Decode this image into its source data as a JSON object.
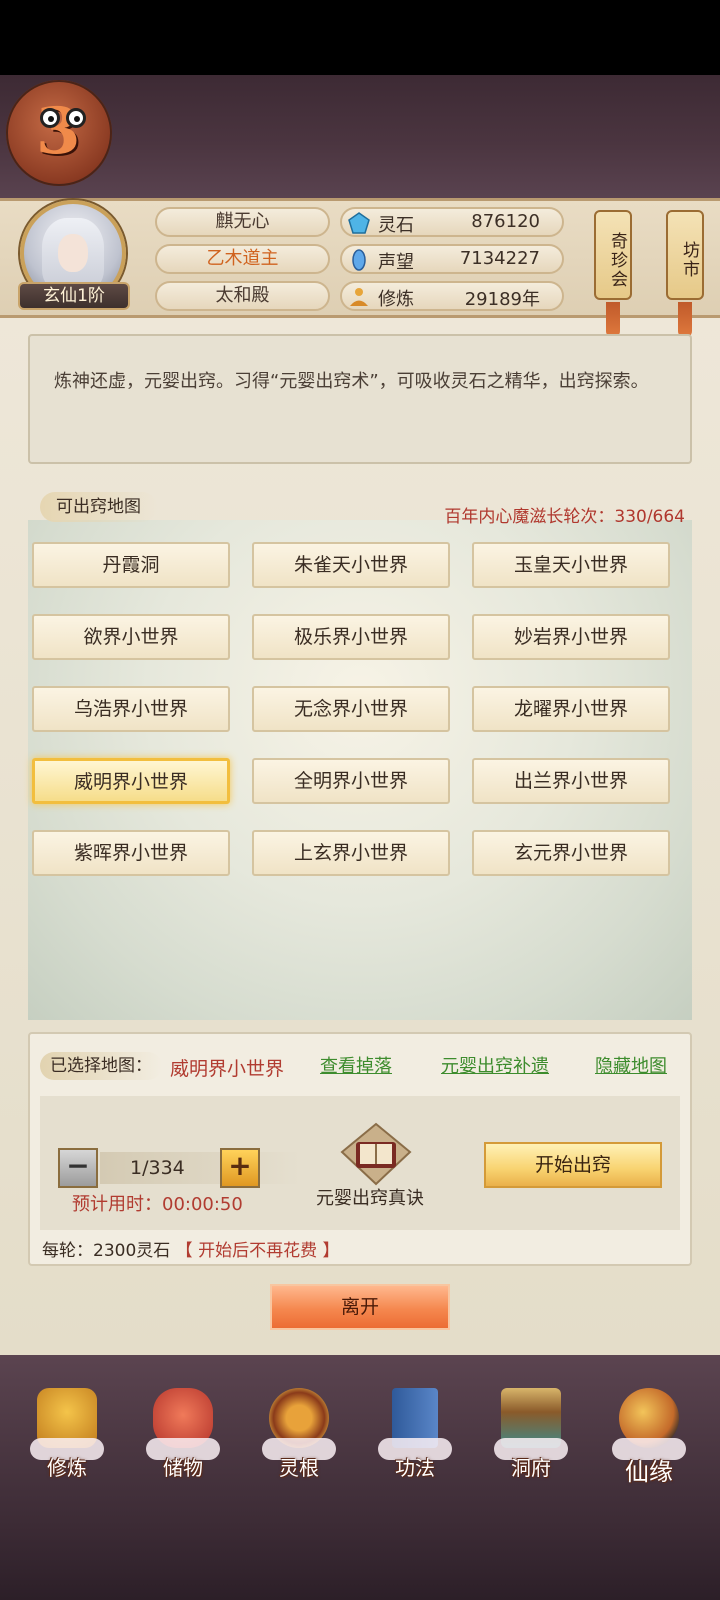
{
  "player": {
    "name": "麒无心",
    "title": "乙木道主",
    "sect": "太和殿",
    "rank": "玄仙1阶"
  },
  "stats": [
    {
      "icon": "spirit-stone-icon",
      "label": "灵石",
      "value": "876120"
    },
    {
      "icon": "prestige-icon",
      "label": "声望",
      "value": "7134227"
    },
    {
      "icon": "cultivation-icon",
      "label": "修炼",
      "value": "29189年"
    }
  ],
  "side_buttons": [
    "奇珍会",
    "坊市"
  ],
  "description": "炼神还虚，元婴出窍。习得“元婴出窍术”，可吸收灵石之精华，出窍探索。",
  "map_section": {
    "label": "可出窍地图",
    "counter": "百年内心魔滋长轮次：330/664"
  },
  "maps": [
    "丹霞洞",
    "朱雀天小世界",
    "玉皇天小世界",
    "欲界小世界",
    "极乐界小世界",
    "妙岩界小世界",
    "乌浩界小世界",
    "无念界小世界",
    "龙曜界小世界",
    "威明界小世界",
    "全明界小世界",
    "出兰界小世界",
    "紫晖界小世界",
    "上玄界小世界",
    "玄元界小世界"
  ],
  "selected_map_index": 9,
  "selection": {
    "label": "已选择地图：",
    "value": "威明界小世界",
    "links": [
      "查看掉落",
      "元婴出窍补遗",
      "隐藏地图"
    ]
  },
  "stepper": {
    "minus": "−",
    "plus": "+",
    "value": "1/334",
    "estimate": "预计用时：00:00:50"
  },
  "book_label": "元婴出窍真诀",
  "start_button": "开始出窍",
  "cost": {
    "prefix": "每轮：2300灵石",
    "note": "【 开始后不再花费 】"
  },
  "leave_button": "离开",
  "nav": [
    "修炼",
    "储物",
    "灵根",
    "功法",
    "洞府",
    "仙缘"
  ],
  "colors": {
    "accent_red": "#b13c31",
    "link_green": "#3d8c2d",
    "gold": "#f2be3e"
  }
}
